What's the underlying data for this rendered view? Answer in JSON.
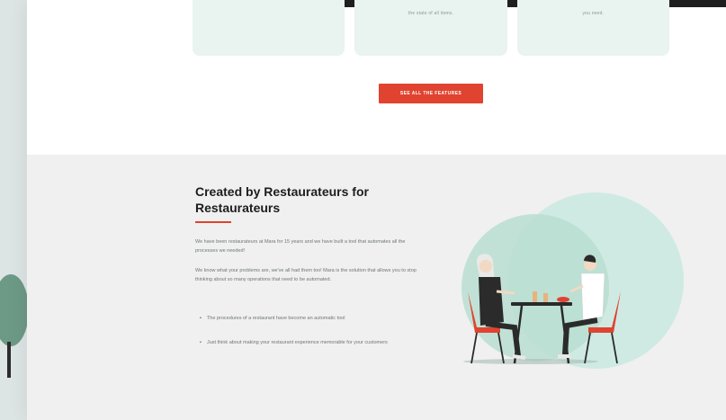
{
  "features": {
    "cards": [
      {
        "text": ""
      },
      {
        "text": "the state of all items."
      },
      {
        "text": "you need."
      }
    ],
    "cta_label": "SEE ALL THE FEATURES"
  },
  "about": {
    "heading": "Created by Restaurateurs for Restaurateurs",
    "paragraph1": "We have been restaurateurs at Mara for 15 years and we have built a tool that automates all the processes we needed!",
    "paragraph2": "We know what your problems are, we've all had them too! Mara is the solution that allows you to stop thinking about so many operations that need to be automated.",
    "bullets": [
      "The procedures of a restaurant have become an automatic tool",
      "Just think about making your restaurant experience memorable for your customers"
    ]
  },
  "colors": {
    "accent": "#e0432f",
    "mint": "#cfeae2",
    "section_bg": "#f0f0f0"
  }
}
